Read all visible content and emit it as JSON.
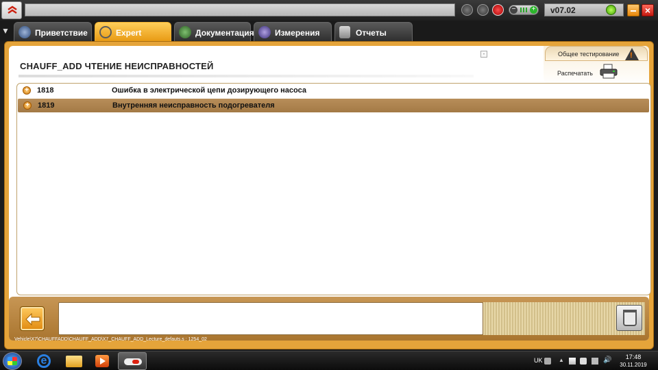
{
  "app": {
    "version": "v07.02"
  },
  "tabs": [
    {
      "label": "Приветствие",
      "active": false
    },
    {
      "label": "Expert",
      "active": true
    },
    {
      "label": "Документация",
      "active": false
    },
    {
      "label": "Измерения",
      "active": false
    },
    {
      "label": "Отчеты",
      "active": false
    }
  ],
  "page": {
    "title": "CHAUFF_ADD  ЧТЕНИЕ НЕИСПРАВНОСТЕЙ"
  },
  "actions": {
    "general_test": "Общее тестирование",
    "print": "Распечатать"
  },
  "faults": [
    {
      "code": "1818",
      "description": "Ошибка в электрической цепи дозирующего насоса",
      "selected": false
    },
    {
      "code": "1819",
      "description": "Внутренняя неисправность подогревателя",
      "selected": true
    }
  ],
  "footer": {
    "path": "Vehicle\\X7\\CHAUFFADD\\CHAUFF_ADD\\X7_CHAUFF_ADD_Lecture_defauts.s : 1254_02"
  },
  "taskbar": {
    "language": "UK",
    "time": "17:48",
    "date": "30.11.2019"
  },
  "icons": {
    "accent": "#e8a030",
    "selected_row": "#a37a45"
  }
}
